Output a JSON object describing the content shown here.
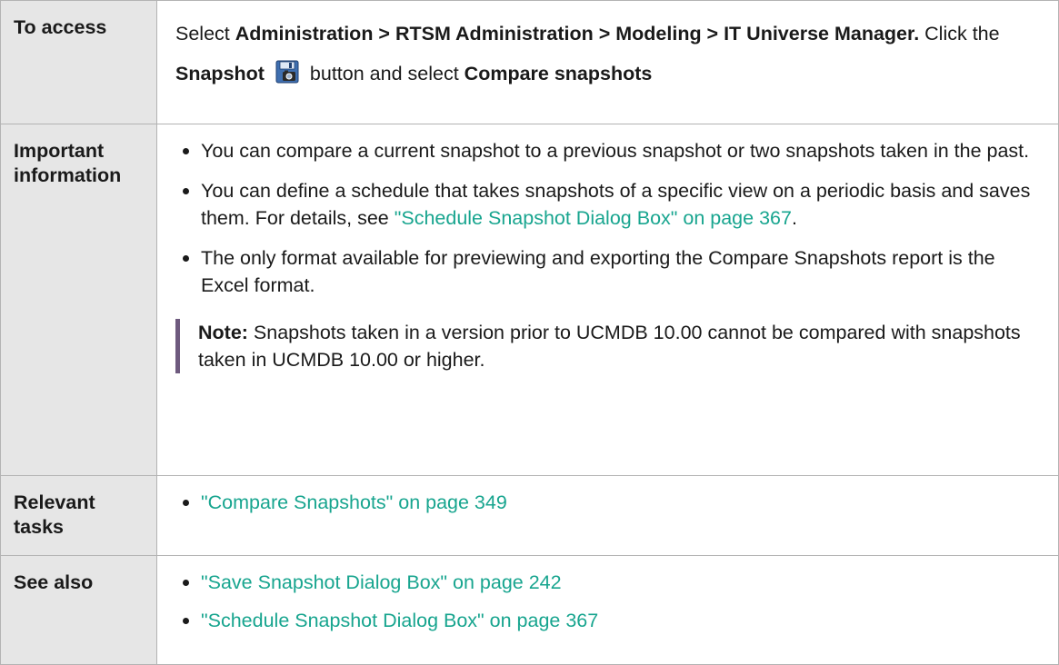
{
  "rows": {
    "access": {
      "label": "To access",
      "select_word": "Select",
      "path": "Administration > RTSM Administration > Modeling > IT Universe Manager.",
      "click_text": "Click the",
      "snapshot_label": "Snapshot",
      "button_text": "button and select",
      "compare_label": "Compare snapshots",
      "icon": "save-snapshot-icon"
    },
    "important": {
      "label": "Important information",
      "bullet1": "You can compare a current snapshot to a previous snapshot or two snapshots taken in the past.",
      "bullet2_text": "You can define a schedule that takes snapshots of a specific view on a periodic basis and saves them. For details, see",
      "bullet2_link": "\"Schedule Snapshot Dialog Box\" on page 367",
      "bullet2_end": ".",
      "bullet3": "The only format available for previewing and exporting the Compare Snapshots report is the Excel format.",
      "note_label": "Note:",
      "note_text": "Snapshots taken in a version prior to UCMDB 10.00 cannot be compared with snapshots taken in UCMDB 10.00 or higher."
    },
    "tasks": {
      "label": "Relevant tasks",
      "link1": "\"Compare Snapshots\" on page 349"
    },
    "see_also": {
      "label": "See also",
      "link1": "\"Save Snapshot Dialog Box\" on page 242",
      "link2": "\"Schedule Snapshot Dialog Box\" on page 367"
    }
  },
  "colors": {
    "link": "#18a58f",
    "header_bg": "#e6e6e6",
    "note_bar": "#6e5a7e"
  }
}
